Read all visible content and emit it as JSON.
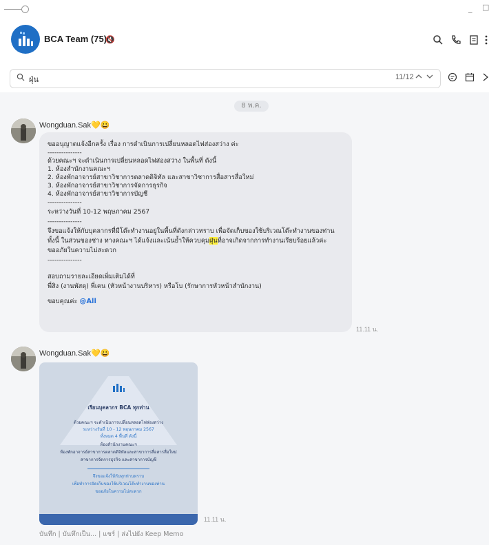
{
  "window": {
    "minimize": "_",
    "maximize": "□"
  },
  "header": {
    "title": "BCA Team (75)",
    "mute_glyph": "🔇",
    "icons": [
      "search-icon",
      "phone-icon",
      "notes-icon",
      "more-icon"
    ]
  },
  "search": {
    "query": "ฝุ่น",
    "count": "11/12",
    "icons": [
      "chevron-up-icon",
      "chevron-down-icon",
      "chat-icon",
      "calendar-icon",
      "close-icon"
    ]
  },
  "chat": {
    "date_label": "8 พ.ค.",
    "messages": [
      {
        "sender": "Wongduan.Sak💛😀",
        "time": "11.11 น.",
        "lines": [
          "ขออนุญาตแจ้งอีกครั้ง เรื่อง การดำเนินการเปลี่ยนหลอดไฟส่องสว่าง ค่ะ",
          "---------------",
          "ด้วยคณะฯ จะดำเนินการเปลี่ยนหลอดไฟส่องสว่าง ในพื้นที่ ดังนี้",
          "1. ห้องสำนักงานคณะฯ",
          "2. ห้องพักอาจารย์สาขาวิชาการตลาดดิจิทัล และสาขาวิชาการสื่อสารสื่อใหม่",
          "3. ห้องพักอาจารย์สาขาวิชาการจัดการธุรกิจ",
          "4. ห้องพักอาจารย์สาขาวิชาการบัญชี",
          "---------------",
          "ระหว่างวันที่ 10-12 พฤษภาคม 2567",
          "---------------",
          "จึงขอแจ้งให้กับบุคลากรที่มีโต๊ะทำงานอยู่ในพื้นที่ดังกล่าวทราบ เพื่อจัดเก็บของใช้บริเวณโต๊ะทำงานของท่าน",
          "ทั้งนี้ ในส่วนของช่าง ทางคณะฯ ได้แจ้งและเน้นย้ำให้ควบคุม",
          "ฝุ่น",
          "ที่อาจเกิดจากการทำงานเรียบร้อยแล้วค่ะ",
          "ขออภัยในความไม่สะดวก",
          "---------------",
          "สอบถามรายละเอียดเพิ่มเติมได้ที่",
          "พี่สิง (งานพัสดุ) พี่เคน (หัวหน้างานบริหาร) หรือโบ (รักษาการหัวหน้าสำนักงาน)",
          "ขอบคุณค่ะ",
          "@All"
        ]
      },
      {
        "sender": "Wongduan.Sak💛😀",
        "time": "11.11 น.",
        "poster_lines": [
          "เรียนบุคลากร BCA ทุกท่าน",
          "ด้วยคณะฯ จะดำเนินการเปลี่ยนหลอดไฟส่องสว่าง",
          "ระหว่างวันที่ 10 - 12 พฤษภาคม 2567",
          "ทั้งหมด 4 พื้นที่ ดังนี้",
          "ห้องสำนักงานคณะฯ",
          "ห้องพักอาจารย์สาขาการตลาดดิจิทัลและสาขาการสื่อสารสื่อใหม่",
          "สาขาการจัดการธุรกิจ และสาขาการบัญชี",
          "จึงขอแจ้งให้กับทุกท่านทราบ",
          "เพื่อทำการจัดเก็บของใช้บริเวณโต๊ะทำงานของท่าน",
          "ขออภัยในความไม่สะดวก"
        ]
      }
    ],
    "actions": "บันทึก | บันทึกเป็น... | แชร์ | ส่งไปยัง Keep Memo"
  },
  "colors": {
    "accent": "#1f6fc5",
    "mention": "#2a73d9",
    "highlight": "#ffef3a",
    "bubble": "#e9eaee"
  }
}
